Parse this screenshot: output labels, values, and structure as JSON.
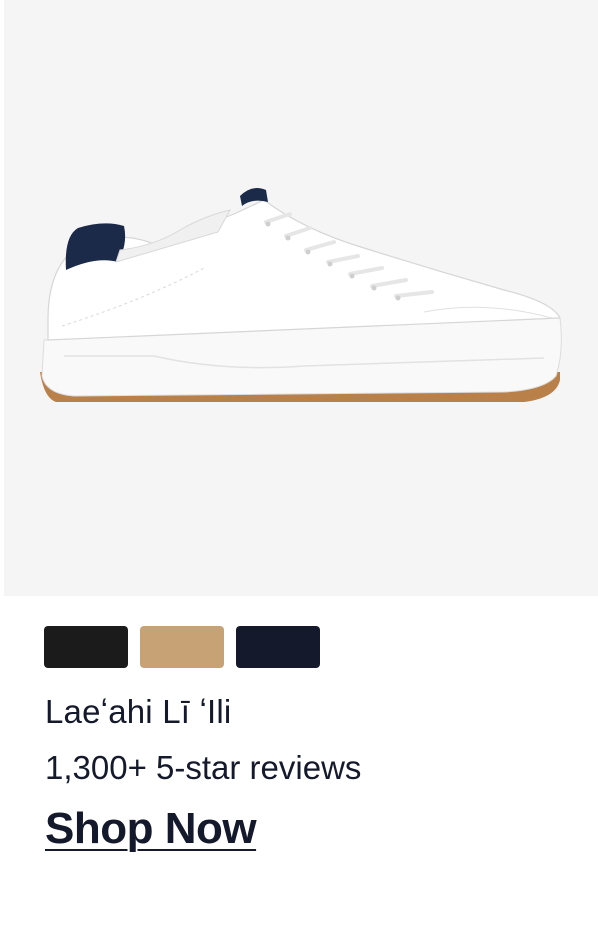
{
  "product": {
    "image_alt": "White leather sneaker with navy heel tab and gum sole",
    "swatches": [
      {
        "name": "black",
        "color": "#1c1b1b"
      },
      {
        "name": "tan",
        "color": "#c6a274"
      },
      {
        "name": "navy",
        "color": "#141a2c"
      }
    ],
    "name": "Laeʻahi Lī ʻIli",
    "reviews": "1,300+ 5-star reviews",
    "cta_label": "Shop Now"
  },
  "colors": {
    "text": "#14192b",
    "hero_bg": "#f5f5f5",
    "heel_accent": "#1c2a4a",
    "gum_sole": "#b9804a"
  }
}
